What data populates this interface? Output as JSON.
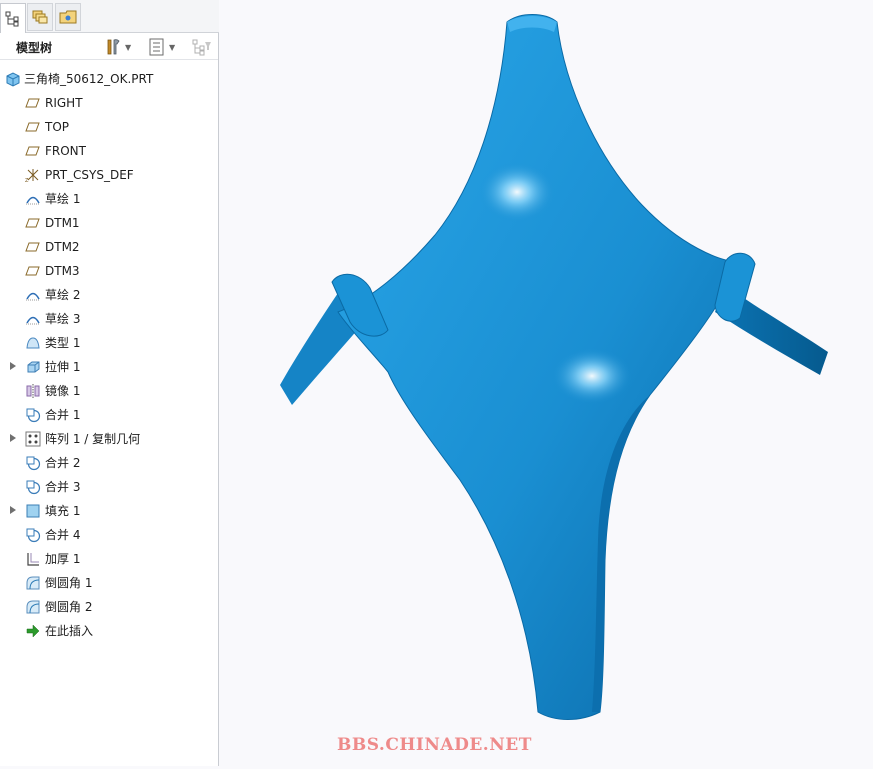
{
  "sidebar": {
    "tabs": [
      {
        "name": "model-tree-tab-icon",
        "active": true
      },
      {
        "name": "layers-tab-icon",
        "active": false
      },
      {
        "name": "folder-browser-tab-icon",
        "active": false
      }
    ],
    "title": "模型树",
    "tree": [
      {
        "label": "三角椅_50612_OK.PRT",
        "icon": "part-icon",
        "expandable": false,
        "root": true
      },
      {
        "label": "RIGHT",
        "icon": "datum-plane-icon",
        "expandable": false
      },
      {
        "label": "TOP",
        "icon": "datum-plane-icon",
        "expandable": false
      },
      {
        "label": "FRONT",
        "icon": "datum-plane-icon",
        "expandable": false
      },
      {
        "label": "PRT_CSYS_DEF",
        "icon": "coordinate-system-icon",
        "expandable": false
      },
      {
        "label": "草绘 1",
        "icon": "sketch-icon",
        "expandable": false
      },
      {
        "label": "DTM1",
        "icon": "datum-plane-icon",
        "expandable": false
      },
      {
        "label": "DTM2",
        "icon": "datum-plane-icon",
        "expandable": false
      },
      {
        "label": "DTM3",
        "icon": "datum-plane-icon",
        "expandable": false
      },
      {
        "label": "草绘 2",
        "icon": "sketch-icon",
        "expandable": false
      },
      {
        "label": "草绘 3",
        "icon": "sketch-icon",
        "expandable": false
      },
      {
        "label": "类型 1",
        "icon": "style-surface-icon",
        "expandable": false
      },
      {
        "label": "拉伸 1",
        "icon": "extrude-icon",
        "expandable": true
      },
      {
        "label": "镜像 1",
        "icon": "mirror-icon",
        "expandable": false
      },
      {
        "label": "合并 1",
        "icon": "merge-icon",
        "expandable": false
      },
      {
        "label": "阵列 1 / 复制几何",
        "icon": "pattern-icon",
        "expandable": true
      },
      {
        "label": "合并 2",
        "icon": "merge-icon",
        "expandable": false
      },
      {
        "label": "合并 3",
        "icon": "merge-icon",
        "expandable": false
      },
      {
        "label": "填充 1",
        "icon": "fill-icon",
        "expandable": true
      },
      {
        "label": "合并 4",
        "icon": "merge-icon",
        "expandable": false
      },
      {
        "label": "加厚 1",
        "icon": "thicken-icon",
        "expandable": false
      },
      {
        "label": "倒圆角 1",
        "icon": "round-icon",
        "expandable": false
      },
      {
        "label": "倒圆角 2",
        "icon": "round-icon",
        "expandable": false
      },
      {
        "label": "在此插入",
        "icon": "insert-here-arrow-icon",
        "expandable": false
      }
    ]
  },
  "viewport": {
    "watermark": "BBS.CHINADE.NET",
    "model_color": "#1a8fd2"
  }
}
